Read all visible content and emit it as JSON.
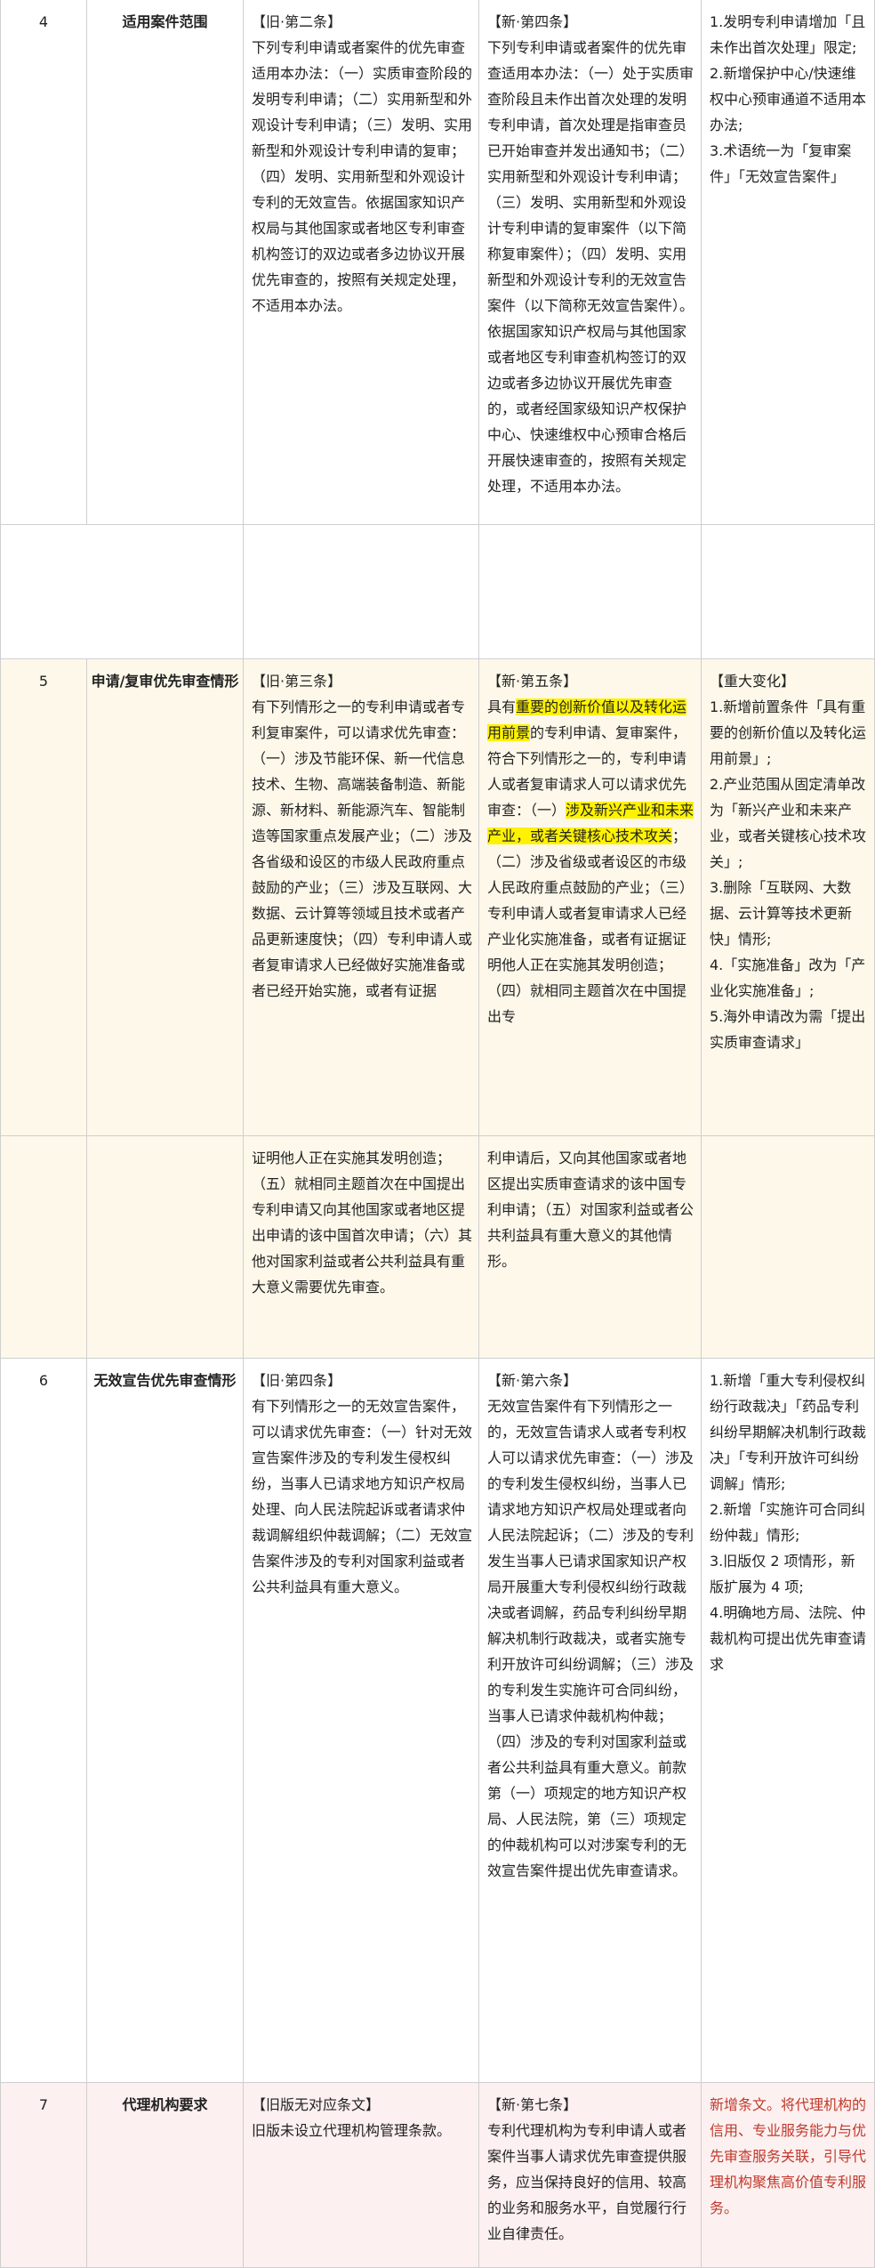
{
  "rows": [
    {
      "num": "4",
      "topic": "适用案件范围",
      "old_head": "【旧·第二条】",
      "old_text": "下列专利申请或者案件的优先审查适用本办法：（一）实质审查阶段的发明专利申请；（二）实用新型和外观设计专利申请；（三）发明、实用新型和外观设计专利申请的复审；（四）发明、实用新型和外观设计专利的无效宣告。依据国家知识产权局与其他国家或者地区专利审查机构签订的双边或者多边协议开展优先审查的，按照有关规定处理，不适用本办法。",
      "new_head": "【新·第四条】",
      "new_text": "下列专利申请或者案件的优先审查适用本办法：（一）处于实质审查阶段且未作出首次处理的发明专利申请，首次处理是指审查员已开始审查并发出通知书；（二）实用新型和外观设计专利申请；（三）发明、实用新型和外观设计专利申请的复审案件（以下简称复审案件）；（四）发明、实用新型和外观设计专利的无效宣告案件（以下简称无效宣告案件）。依据国家知识产权局与其他国家或者地区专利审查机构签订的双边或者多边协议开展优先审查的，或者经国家级知识产权保护中心、快速维权中心预审合格后开展快速审查的，按照有关规定处理，不适用本办法。",
      "change_items": [
        "1.发明专利申请增加「且未作出首次处理」限定;",
        "2.新增保护中心/快速维权中心预审通道不适用本办法;",
        "3.术语统一为「复审案件」「无效宣告案件」"
      ]
    },
    {
      "num": "5",
      "topic": "申请/复审优先审查情形",
      "old_head": "【旧·第三条】",
      "old_text": "有下列情形之一的专利申请或者专利复审案件，可以请求优先审查：（一）涉及节能环保、新一代信息技术、生物、高端装备制造、新能源、新材料、新能源汽车、智能制造等国家重点发展产业；（二）涉及各省级和设区的市级人民政府重点鼓励的产业；（三）涉及互联网、大数据、云计算等领域且技术或者产品更新速度快；（四）专利申请人或者复审请求人已经做好实施准备或者已经开始实施，或者有证据",
      "old_text_cont": "证明他人正在实施其发明创造；（五）就相同主题首次在中国提出专利申请又向其他国家或者地区提出申请的该中国首次申请；（六）其他对国家利益或者公共利益具有重大意义需要优先审查。",
      "new_head": "【新·第五条】",
      "new_pre": "具有",
      "new_hl1": "重要的创新价值以及转化运用前景",
      "new_mid": "的专利申请、复审案件，符合下列情形之一的，专利申请人或者复审请求人可以请求优先审查：（一）",
      "new_hl2": "涉及新兴产业和未来产业，或者关键核心技术攻关",
      "new_post": "；（二）涉及省级或者设区的市级人民政府重点鼓励的产业；（三）专利申请人或者复审请求人已经产业化实施准备，或者有证据证明他人正在实施其发明创造；（四）就相同主题首次在中国提出专",
      "new_text_cont": "利申请后，又向其他国家或者地区提出实质审查请求的该中国专利申请；（五）对国家利益或者公共利益具有重大意义的其他情形。",
      "change_head": "【重大变化】",
      "change_items": [
        "1.新增前置条件「具有重要的创新价值以及转化运用前景」;",
        "2.产业范围从固定清单改为「新兴产业和未来产业，或者关键核心技术攻关」;",
        "3.删除「互联网、大数据、云计算等技术更新快」情形;",
        "4.「实施准备」改为「产业化实施准备」;",
        "5.海外申请改为需「提出实质审查请求」"
      ]
    },
    {
      "num": "6",
      "topic": "无效宣告优先审查情形",
      "old_head": "【旧·第四条】",
      "old_text": "有下列情形之一的无效宣告案件，可以请求优先审查：（一）针对无效宣告案件涉及的专利发生侵权纠纷，当事人已请求地方知识产权局处理、向人民法院起诉或者请求仲裁调解组织仲裁调解；（二）无效宣告案件涉及的专利对国家利益或者公共利益具有重大意义。",
      "new_head": "【新·第六条】",
      "new_text": "无效宣告案件有下列情形之一的，无效宣告请求人或者专利权人可以请求优先审查：（一）涉及的专利发生侵权纠纷，当事人已请求地方知识产权局处理或者向人民法院起诉；（二）涉及的专利发生当事人已请求国家知识产权局开展重大专利侵权纠纷行政裁决或者调解，药品专利纠纷早期解决机制行政裁决，或者实施专利开放许可纠纷调解；（三）涉及的专利发生实施许可合同纠纷，当事人已请求仲裁机构仲裁；（四）涉及的专利对国家利益或者公共利益具有重大意义。前款第（一）项规定的地方知识产权局、人民法院，第（三）项规定的仲裁机构可以对涉案专利的无效宣告案件提出优先审查请求。",
      "change_items": [
        "1.新增「重大专利侵权纠纷行政裁决」「药品专利纠纷早期解决机制行政裁决」「专利开放许可纠纷调解」情形;",
        "2.新增「实施许可合同纠纷仲裁」情形;",
        "3.旧版仅 2 项情形，新版扩展为 4 项;",
        "4.明确地方局、法院、仲裁机构可提出优先审查请求"
      ]
    },
    {
      "num": "7",
      "topic": "代理机构要求",
      "old_head": "【旧版无对应条文】",
      "old_text": "旧版未设立代理机构管理条款。",
      "new_head": "【新·第七条】",
      "new_text": "专利代理机构为专利申请人或者案件当事人请求优先审查提供服务，应当保持良好的信用、较高的业务和服务水平，自觉履行行业自律责任。",
      "change_text": "新增条文。将代理机构的信用、专业服务能力与优先审查服务关联，引导代理机构聚焦高价值专利服务。"
    }
  ]
}
